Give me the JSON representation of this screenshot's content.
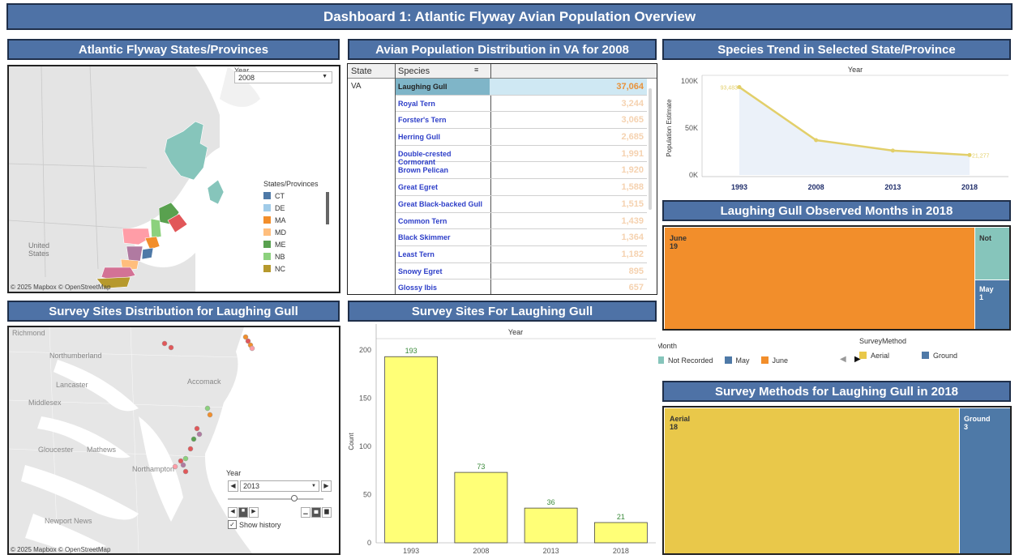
{
  "dashboard_title": "Dashboard 1: Atlantic Flyway Avian Population Overview",
  "panels": {
    "map1_title": "Atlantic Flyway States/Provinces",
    "table_title": "Avian Population Distribution in VA for 2008",
    "trend_title": "Species Trend in Selected State/Province",
    "months_title": "Laughing Gull Observed Months in 2018",
    "sites_map_title": "Survey Sites Distribution for Laughing Gull",
    "sites_bar_title": "Survey Sites For Laughing Gull",
    "methods_title": "Survey Methods for Laughing Gull in 2018"
  },
  "map1": {
    "year_label": "Year",
    "year_value": "2008",
    "legend_title": "States/Provinces",
    "legend": [
      {
        "code": "CT",
        "color": "#4e79a7"
      },
      {
        "code": "DE",
        "color": "#a0cbe8"
      },
      {
        "code": "MA",
        "color": "#f28e2b"
      },
      {
        "code": "MD",
        "color": "#ffbe7d"
      },
      {
        "code": "ME",
        "color": "#59a14f"
      },
      {
        "code": "NB",
        "color": "#8cd17d"
      },
      {
        "code": "NC",
        "color": "#b6992d"
      }
    ],
    "country_label_1": "United",
    "country_label_2": "States",
    "attribution": "© 2025 Mapbox © OpenStreetMap"
  },
  "table": {
    "col_state": "State",
    "col_species": "Species",
    "state": "VA",
    "rows": [
      {
        "species": "Laughing Gull",
        "value": "37,064"
      },
      {
        "species": "Royal Tern",
        "value": "3,244"
      },
      {
        "species": "Forster's Tern",
        "value": "3,065"
      },
      {
        "species": "Herring Gull",
        "value": "2,685"
      },
      {
        "species": "Double-crested Cormorant",
        "value": "1,991"
      },
      {
        "species": "Brown Pelican",
        "value": "1,920"
      },
      {
        "species": "Great Egret",
        "value": "1,588"
      },
      {
        "species": "Great Black-backed Gull",
        "value": "1,515"
      },
      {
        "species": "Common Tern",
        "value": "1,439"
      },
      {
        "species": "Black Skimmer",
        "value": "1,364"
      },
      {
        "species": "Least Tern",
        "value": "1,182"
      },
      {
        "species": "Snowy Egret",
        "value": "895"
      },
      {
        "species": "Glossy Ibis",
        "value": "657"
      }
    ]
  },
  "trend": {
    "axis_title": "Year",
    "ylabel": "Population Estimate",
    "yticks": [
      "100K",
      "50K",
      "0K"
    ],
    "first_label": "93,483",
    "last_label": "21,277"
  },
  "months": {
    "june_label": "June",
    "june_count": "19",
    "notrec_label": "Not",
    "may_label": "May",
    "may_count": "1"
  },
  "legends": {
    "month_title": "Month",
    "month_items": [
      {
        "label": "Not Recorded",
        "color": "#86c5bb"
      },
      {
        "label": "May",
        "color": "#4e79a7"
      },
      {
        "label": "June",
        "color": "#f28e2b"
      }
    ],
    "method_title": "SurveyMethod",
    "method_items": [
      {
        "label": "Aerial",
        "color": "#e9c84a"
      },
      {
        "label": "Ground",
        "color": "#4e79a7"
      }
    ]
  },
  "sites_map": {
    "places": [
      "Richmond",
      "Northumberland",
      "Lancaster",
      "Middlesex",
      "Accomack",
      "Gloucester",
      "Mathews",
      "Northampton",
      "Newport News"
    ],
    "year_label": "Year",
    "year_value": "2013",
    "show_history": "Show history",
    "attribution": "© 2025 Mapbox © OpenStreetMap"
  },
  "methods": {
    "aerial_label": "Aerial",
    "aerial_count": "18",
    "ground_label": "Ground",
    "ground_count": "3"
  },
  "chart_data": [
    {
      "type": "line",
      "title": "Species Trend in Selected State/Province",
      "xlabel": "Year",
      "ylabel": "Population Estimate",
      "x": [
        "1993",
        "2008",
        "2013",
        "2018"
      ],
      "series": [
        {
          "values": [
            93483,
            37064,
            26000,
            21277
          ]
        }
      ],
      "ylim": [
        0,
        100000
      ]
    },
    {
      "type": "bar",
      "title": "Survey Sites For Laughing Gull",
      "xlabel": "Year",
      "ylabel": "Count",
      "categories": [
        "1993",
        "2008",
        "2013",
        "2018"
      ],
      "values": [
        193,
        73,
        36,
        21
      ],
      "yticks": [
        0,
        50,
        100,
        150,
        200
      ],
      "ylim": [
        0,
        210
      ]
    },
    {
      "type": "bar",
      "title": "Laughing Gull Observed Months in 2018",
      "categories": [
        "June",
        "Not",
        "May"
      ],
      "values": [
        19,
        1,
        1
      ]
    },
    {
      "type": "bar",
      "title": "Survey Methods for Laughing Gull in 2018",
      "categories": [
        "Aerial",
        "Ground"
      ],
      "values": [
        18,
        3
      ]
    }
  ]
}
